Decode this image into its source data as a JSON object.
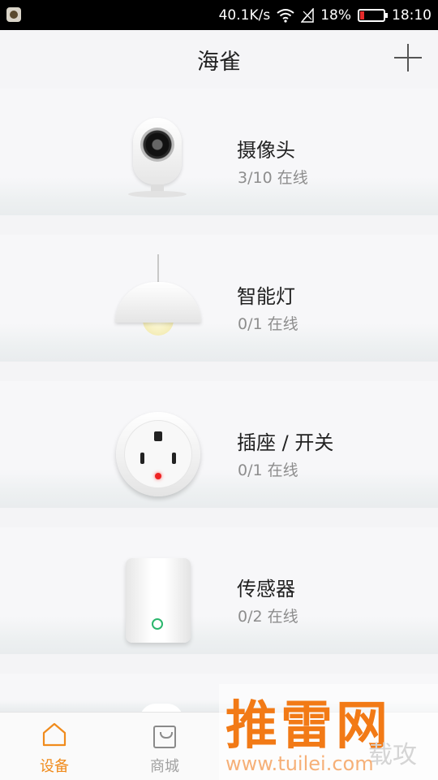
{
  "status_bar": {
    "speed": "40.1K/s",
    "battery": "18%",
    "battery_level": 0.18,
    "time": "18:10",
    "colors": {
      "battery_low": "#e52b2b"
    }
  },
  "header": {
    "title": "海雀",
    "add_icon": "plus-icon"
  },
  "devices": [
    {
      "name": "摄像头",
      "status": "3/10 在线",
      "icon": "camera-icon"
    },
    {
      "name": "智能灯",
      "status": "0/1 在线",
      "icon": "lamp-icon"
    },
    {
      "name": "插座 / 开关",
      "status": "0/1 在线",
      "icon": "socket-icon"
    },
    {
      "name": "传感器",
      "status": "0/2 在线",
      "icon": "sensor-icon"
    }
  ],
  "tabs": [
    {
      "label": "设备",
      "icon": "home-icon",
      "active": true
    },
    {
      "label": "商城",
      "icon": "shopping-bag-icon",
      "active": false
    }
  ],
  "watermark": {
    "main": "推雷网",
    "url": "www.tuilei.com",
    "side": "载攻"
  },
  "colors": {
    "accent": "#f08b1c",
    "background": "#f4f4f6"
  }
}
